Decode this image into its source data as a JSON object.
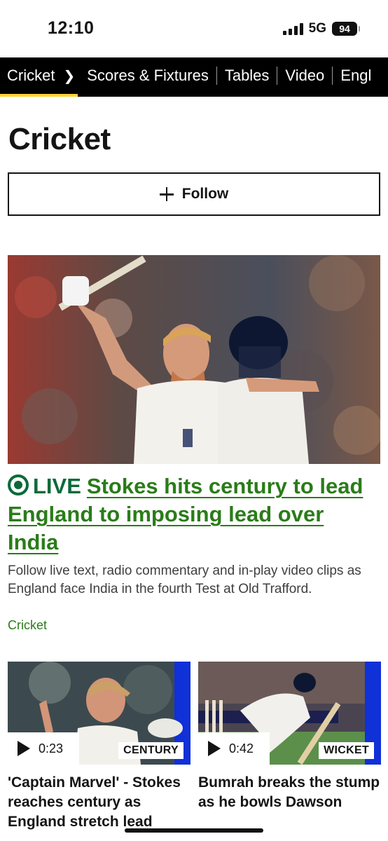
{
  "status_bar": {
    "time": "12:10",
    "network": "5G",
    "battery": "94"
  },
  "nav": {
    "section": "Cricket",
    "items": [
      "Scores & Fixtures",
      "Tables",
      "Video",
      "Engl"
    ]
  },
  "page": {
    "title": "Cricket",
    "follow_label": "Follow"
  },
  "hero": {
    "live_label": "LIVE",
    "headline": "Stokes hits century to lead England to imposing lead over India",
    "summary": "Follow live text, radio commentary and in-play video clips as England face India in the fourth Test at Old Trafford.",
    "topic": "Cricket"
  },
  "cards": [
    {
      "duration": "0:23",
      "badge": "CENTURY",
      "title": "'Captain Marvel' - Stokes reaches century as England stretch lead"
    },
    {
      "duration": "0:42",
      "badge": "WICKET",
      "title": "Bumrah breaks the stump as he bowls Dawson"
    }
  ],
  "colors": {
    "accent": "#ffd230",
    "live_green": "#0b6b3a",
    "link_green": "#2a7c19",
    "nav_bg": "#000000"
  }
}
